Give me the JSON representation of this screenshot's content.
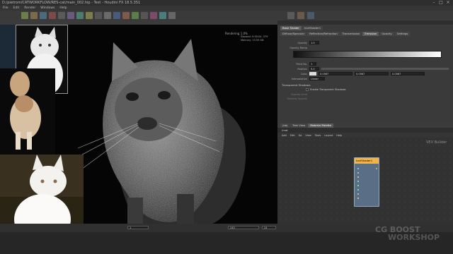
{
  "window": {
    "title": "D:/pietrom/CATWORKFLOW/RES-cat/main_002.hip - Test - Houdini FX 18.5.351",
    "controls": [
      "–",
      "□",
      "×"
    ]
  },
  "menu": [
    "File",
    "Edit",
    "Render",
    "Windows",
    "Help"
  ],
  "viewer": {
    "rendering_label": "Rendering 1.0%",
    "stats_label": "Elapsed: 0:00:04 .379",
    "stats_label2": "Memory: 13.55 GB",
    "cat_subject": "cat-render"
  },
  "refs": {
    "photo1": "white-cat-bw-photo",
    "photo2": "long-haired-cream-cat-photo",
    "photo3": "white-fluffy-cat-photo"
  },
  "params": {
    "tabs": [
      "Base Shader",
      "hairShader1"
    ],
    "subtabs": [
      "Diffuse/Specular",
      "Reflection/Refraction",
      "Transmission",
      "Emission",
      "Opacity",
      "Settings"
    ],
    "rows": [
      {
        "label": "Opacity",
        "value": "1.0"
      },
      {
        "label": "Opacity Ramp",
        "value": ""
      },
      {
        "label": "Point No.",
        "value": "1"
      },
      {
        "label": "Position",
        "value": "0.0"
      },
      {
        "label": "Color",
        "value": ""
      },
      {
        "label": "Interpolation",
        "value": "Linear"
      }
    ],
    "ramp_values": [
      "0.0567",
      "0.0567",
      "0.0567"
    ],
    "section": "Transparent Shadows",
    "checkbox": "Enable Transparent Shadows",
    "sub_rows": [
      "Opacity Limit",
      "Shadow Opacity"
    ]
  },
  "network": {
    "tabs": [
      "/obj",
      "Tree View",
      "Material Palette"
    ],
    "path": "/mat",
    "menus": [
      "Add",
      "Edit",
      "Go",
      "View",
      "Tools",
      "Layout",
      "Help"
    ],
    "label": "VEX Builder",
    "node_name": "hairShader1"
  },
  "timeline": {
    "frame": "1",
    "fps": "24",
    "range_end": "240"
  },
  "colors": {
    "node_header": "#f1b44a",
    "node_body": "#5a6e86",
    "accent": "#f1b44a"
  },
  "watermark": {
    "line1": "CG BOOST",
    "line2": "WORKSHOP"
  }
}
